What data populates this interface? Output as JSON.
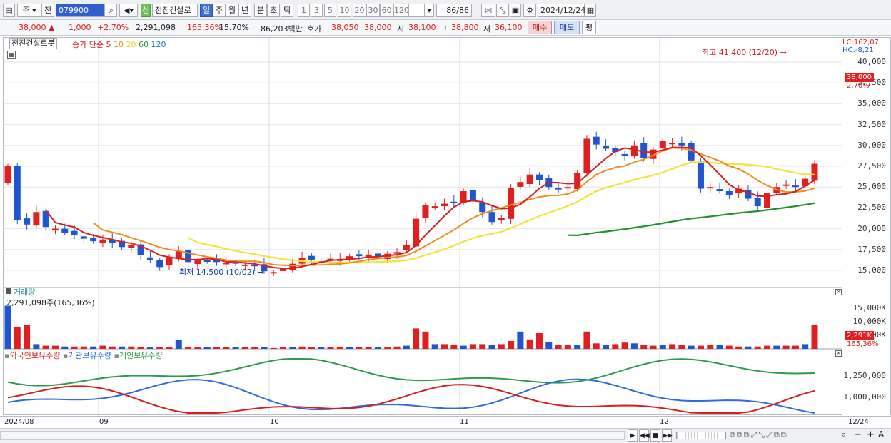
{
  "toolbar": {
    "period_select": "주",
    "prev_label": "전",
    "stock_code": "079900",
    "new_badge": "신",
    "stock_name": "전진건설로",
    "periods": [
      "일",
      "주",
      "월",
      "년",
      "분",
      "초",
      "틱"
    ],
    "active_period": "일",
    "intervals": [
      "1",
      "3",
      "5",
      "10",
      "20",
      "30",
      "60",
      "120"
    ],
    "count": "86/86",
    "date": "2024/12/24"
  },
  "quote": {
    "price": "38,000",
    "change": "1,000",
    "change_rate": "+2.70%",
    "volume": "2,291,098",
    "volume_ratio": "165.36%",
    "turnover": "15.70%",
    "amount": "86,203백만",
    "bid_label": "호가",
    "ask": "38,050",
    "bid": "38,000",
    "open_label": "시",
    "open": "38,100",
    "high_label": "고",
    "high": "38,800",
    "low_label": "저",
    "low": "36,100",
    "buy_label": "매수",
    "sell_label": "매도",
    "avg_label": "평"
  },
  "price_chart": {
    "title": "전진건설로봇",
    "ma_label": "종가 단순",
    "ma_periods": [
      "5",
      "10",
      "20",
      "60",
      "120"
    ],
    "high_note": "최고 41,400 (12/20)",
    "low_note": "최저 14,500 (10/02)",
    "lc": "LC:162,07",
    "hc": "HC:-8,21",
    "current_price": "38,000",
    "current_rate": "2,70%",
    "y_ticks": [
      "40,000",
      "37,500",
      "35,000",
      "32,500",
      "30,000",
      "27,500",
      "25,000",
      "22,500",
      "20,000",
      "17,500",
      "15,000"
    ]
  },
  "volume_chart": {
    "title": "거래량",
    "value": "2,291,098주(165,36%)",
    "current": "2,291K",
    "ratio": "165,36%",
    "y_ticks": [
      "15,000K",
      "10,000K",
      "5,000K"
    ]
  },
  "holdings_chart": {
    "series": [
      "외국인보유수량",
      "기관보유수량",
      "개인보유수량"
    ],
    "y_ticks": [
      "1,250,000",
      "1,000,000"
    ]
  },
  "x_axis": [
    "2024/08",
    "09",
    "10",
    "11",
    "12"
  ],
  "x_axis_right": "12/24",
  "colors": {
    "up": "#e02020",
    "down": "#1f55d0",
    "ma5": "#d81e1e",
    "ma10": "#f08c1e",
    "ma20": "#f2e43a",
    "ma60": "#22922e",
    "foreign": "#d81e1e",
    "institution": "#2f6ae0",
    "individual": "#2d9a4e"
  }
}
